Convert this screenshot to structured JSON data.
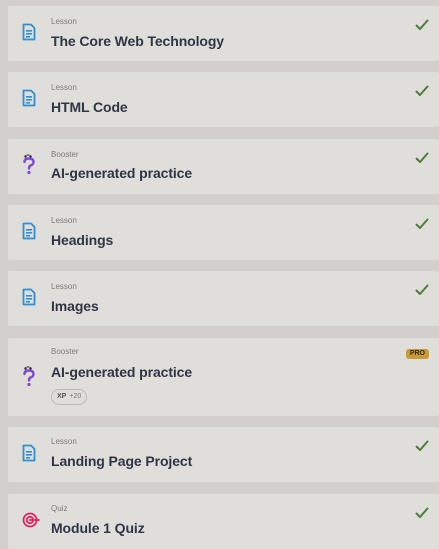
{
  "colors": {
    "background": "#d3cfcc",
    "card": "#e0deda",
    "title": "#2f3545",
    "check": "#4b7d3a",
    "lesson_icon": "#2e8fd3",
    "booster_icon": "#7c4ad0",
    "quiz_icon": "#e0245e",
    "pro_badge": "#c79a3a"
  },
  "items": [
    {
      "type": "Lesson",
      "title": "The Core Web Technology",
      "icon": "lesson-icon",
      "status": "completed"
    },
    {
      "type": "Lesson",
      "title": "HTML Code",
      "icon": "lesson-icon",
      "status": "completed"
    },
    {
      "type": "Booster",
      "title": "AI-generated practice",
      "icon": "booster-icon",
      "status": "completed"
    },
    {
      "type": "Lesson",
      "title": "Headings",
      "icon": "lesson-icon",
      "status": "completed"
    },
    {
      "type": "Lesson",
      "title": "Images",
      "icon": "lesson-icon",
      "status": "completed"
    },
    {
      "type": "Booster",
      "title": "AI-generated practice",
      "icon": "booster-icon",
      "status": "locked",
      "badge": "PRO",
      "xp_label": "XP",
      "xp_value": "+20"
    },
    {
      "type": "Lesson",
      "title": "Landing Page Project",
      "icon": "lesson-icon",
      "status": "completed"
    },
    {
      "type": "Quiz",
      "title": "Module 1 Quiz",
      "icon": "quiz-icon",
      "status": "completed"
    }
  ]
}
